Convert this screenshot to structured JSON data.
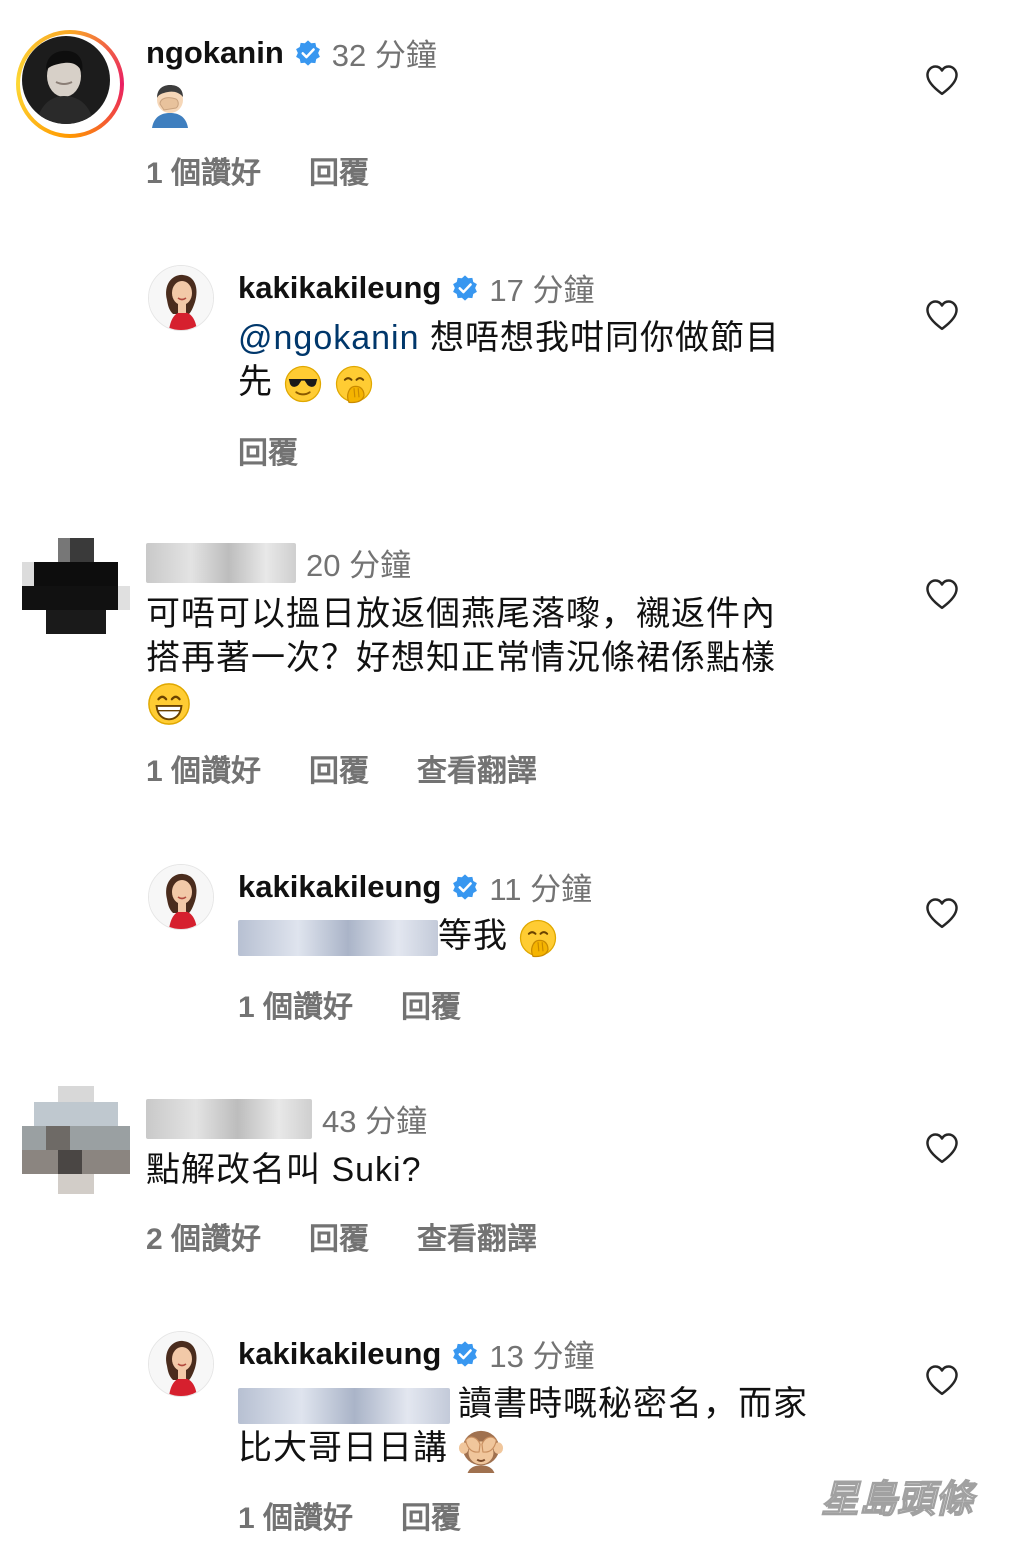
{
  "comments": [
    {
      "username": "ngokanin",
      "time": "32 分鐘",
      "likes": "1 個讚好",
      "reply": "回覆",
      "emoji": "face-palm-emoji"
    },
    {
      "username": "kakikakileung",
      "time": "17 分鐘",
      "mention": "@ngokanin",
      "text_line1": " 想唔想我咁同你做節目",
      "text_line2": "先",
      "reply": "回覆"
    },
    {
      "time": "20 分鐘",
      "text_line1": "可唔可以搵日放返個燕尾落嚟，襯返件內",
      "text_line2": "搭再著一次？好想知正常情況條裙係點樣",
      "likes": "1 個讚好",
      "reply": "回覆",
      "translate": "查看翻譯"
    },
    {
      "username": "kakikakileung",
      "time": "11 分鐘",
      "text": "等我",
      "likes": "1 個讚好",
      "reply": "回覆"
    },
    {
      "time": "43 分鐘",
      "text": "點解改名叫 Suki?",
      "likes": "2 個讚好",
      "reply": "回覆",
      "translate": "查看翻譯"
    },
    {
      "username": "kakikakileung",
      "time": "13 分鐘",
      "text_line1": "讀書時嘅秘密名，而家",
      "text_line2": "比大哥日日講",
      "likes": "1 個讚好",
      "reply": "回覆"
    }
  ],
  "watermark": "星島頭條",
  "colors": {
    "verified": "#3897f0",
    "meta": "#737373",
    "mention": "#00376b"
  }
}
